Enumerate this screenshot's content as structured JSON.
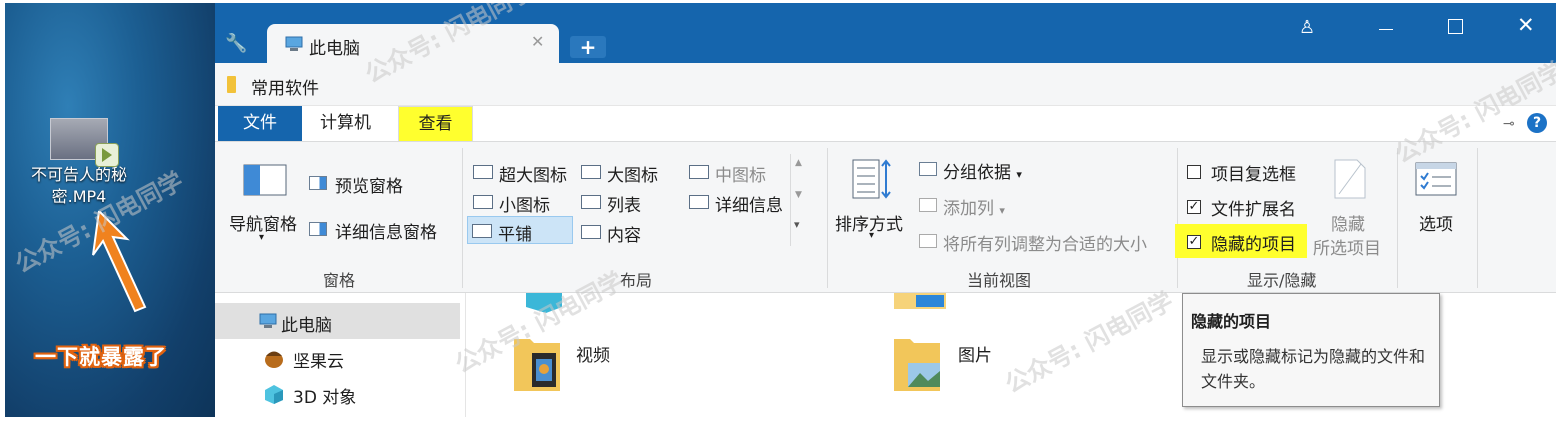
{
  "desktop": {
    "file_label": "不可告人的秘密.MP4",
    "annotation": "一下就暴露了",
    "accent_color": "#e0620f"
  },
  "window": {
    "tab_title": "此电脑",
    "new_tab_symbol": "+",
    "address": "常用软件",
    "title_bar_color": "#1565ad"
  },
  "menu": {
    "file": "文件",
    "computer": "计算机",
    "view": "查看",
    "help_symbol": "?"
  },
  "ribbon": {
    "panes": {
      "label": "窗格",
      "nav_pane": "导航窗格",
      "preview_pane": "预览窗格",
      "details_pane": "详细信息窗格"
    },
    "layout": {
      "label": "布局",
      "items": [
        "超大图标",
        "大图标",
        "中图标",
        "小图标",
        "列表",
        "详细信息",
        "平铺",
        "内容"
      ],
      "selected": "平铺"
    },
    "current_view": {
      "label": "当前视图",
      "sort_by": "排序方式",
      "group_by": "分组依据",
      "add_column": "添加列",
      "fit_columns": "将所有列调整为合适的大小"
    },
    "show_hide": {
      "label": "显示/隐藏",
      "item_checkboxes": "项目复选框",
      "item_checkboxes_checked": false,
      "file_extensions": "文件扩展名",
      "file_extensions_checked": true,
      "hidden_items": "隐藏的项目",
      "hidden_items_checked": true,
      "hide_selected_line1": "隐藏",
      "hide_selected_line2": "所选项目"
    },
    "options": "选项",
    "highlight_color": "#ffff2e"
  },
  "nav": {
    "items": [
      "此电脑",
      "坚果云",
      "3D 对象"
    ]
  },
  "content": {
    "folders": [
      "视频",
      "图片"
    ]
  },
  "tooltip": {
    "title": "隐藏的项目",
    "body": "显示或隐藏标记为隐藏的文件和文件夹。"
  },
  "watermark": {
    "text": "公众号: 闪电同学"
  }
}
